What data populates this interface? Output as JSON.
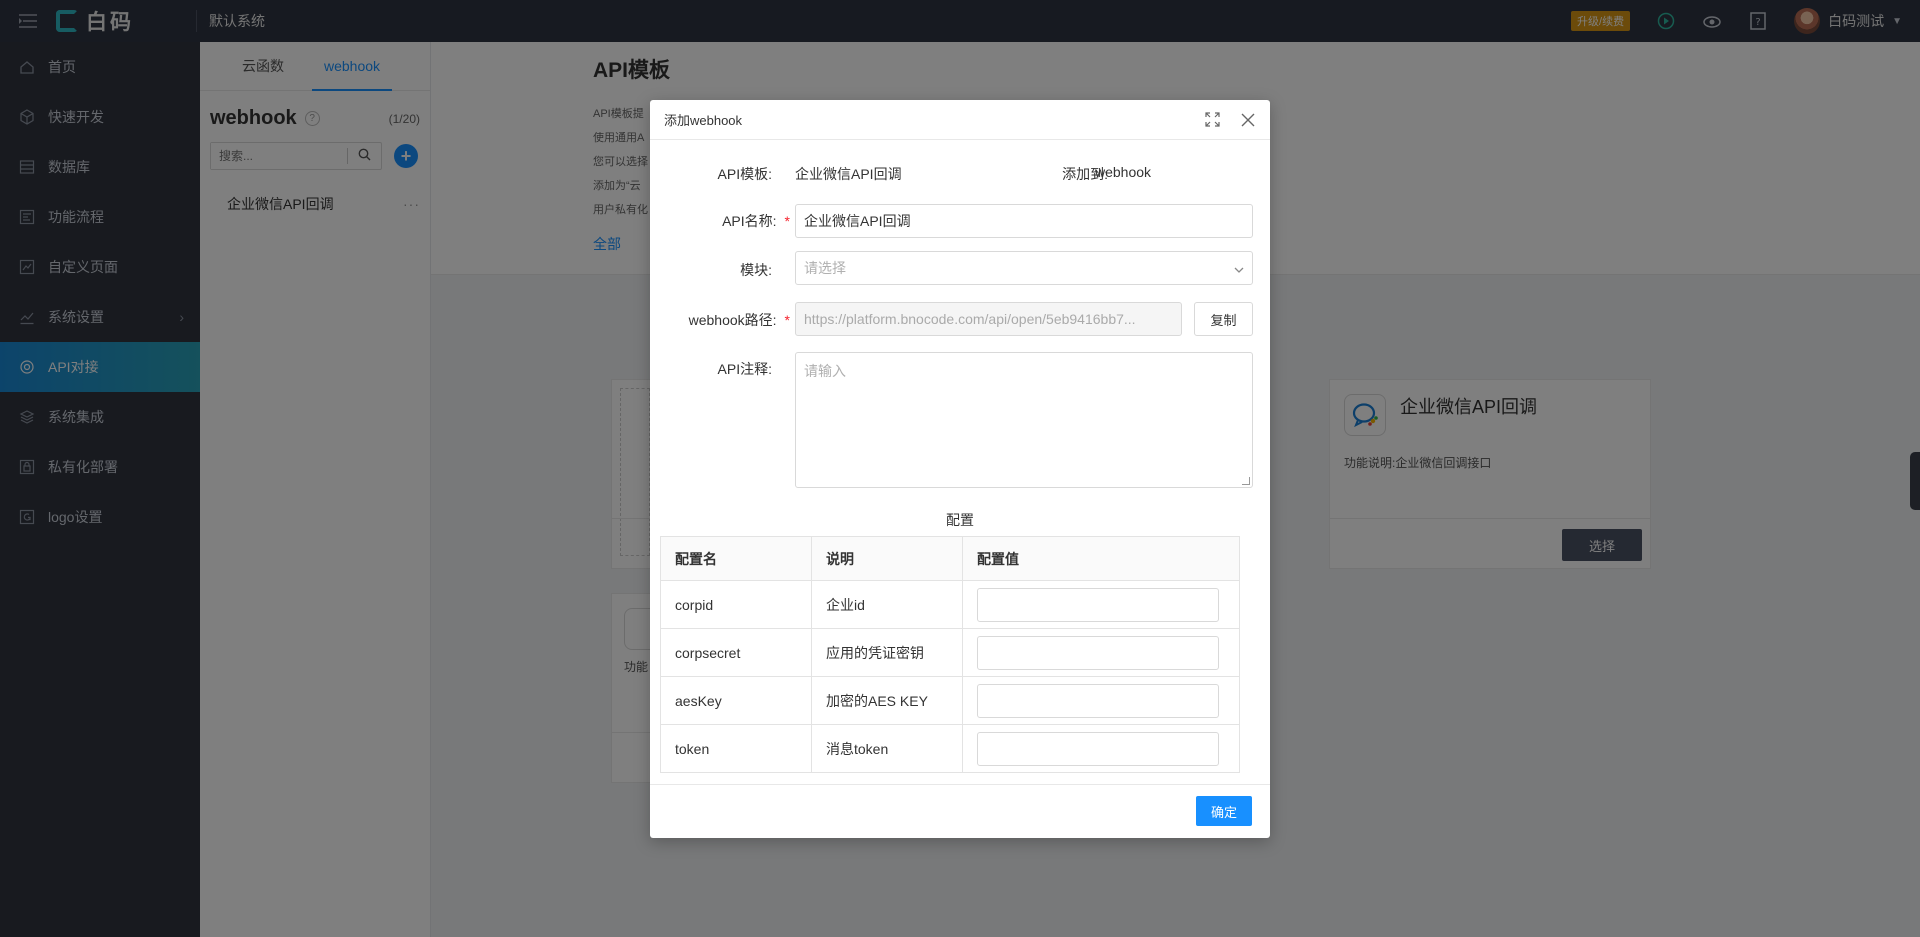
{
  "topbar": {
    "logo_text": "白码",
    "system_name": "默认系统",
    "upgrade_label": "升级/续费",
    "user_name": "白码测试"
  },
  "sidebar": {
    "items": [
      {
        "label": "首页",
        "icon": "home-icon"
      },
      {
        "label": "快速开发",
        "icon": "cube-icon"
      },
      {
        "label": "数据库",
        "icon": "database-icon"
      },
      {
        "label": "功能流程",
        "icon": "flow-icon"
      },
      {
        "label": "自定义页面",
        "icon": "page-icon"
      },
      {
        "label": "系统设置",
        "icon": "chart-icon"
      },
      {
        "label": "API对接",
        "icon": "api-icon"
      },
      {
        "label": "系统集成",
        "icon": "layers-icon"
      },
      {
        "label": "私有化部署",
        "icon": "lock-icon"
      },
      {
        "label": "logo设置",
        "icon": "logo-icon"
      }
    ]
  },
  "panel": {
    "tabs": [
      "云函数",
      "webhook"
    ],
    "title": "webhook",
    "count": "(1/20)",
    "search_placeholder": "搜索...",
    "items": [
      "企业微信API回调"
    ]
  },
  "main": {
    "title": "API模板",
    "desc_lines": [
      "API模板提",
      "使用通用A",
      "您可以选择",
      "添加为“云",
      "用户私有化"
    ],
    "filter_all": "全部",
    "card_right": {
      "title": "企业微信API回调",
      "desc": "功能说明:企业微信回调接口",
      "button": "选择"
    },
    "card_left_bottom_fragment": "功能"
  },
  "modal": {
    "title": "添加webhook",
    "template_label": "API模板:",
    "template_value": "企业微信API回调",
    "add_to_label": "添加到:",
    "add_to_value": "webhook",
    "name_label": "API名称:",
    "name_value": "企业微信API回调",
    "module_label": "模块:",
    "module_placeholder": "请选择",
    "path_label": "webhook路径:",
    "path_value": "https://platform.bnocode.com/api/open/5eb9416bb7...",
    "copy_label": "复制",
    "note_label": "API注释:",
    "note_placeholder": "请输入",
    "config_title": "配置",
    "config_headers": [
      "配置名",
      "说明",
      "配置值"
    ],
    "config_rows": [
      {
        "name": "corpid",
        "desc": "企业id",
        "value": ""
      },
      {
        "name": "corpsecret",
        "desc": "应用的凭证密钥",
        "value": ""
      },
      {
        "name": "aesKey",
        "desc": "加密的AES KEY",
        "value": ""
      },
      {
        "name": "token",
        "desc": "消息token",
        "value": ""
      }
    ],
    "ok_label": "确定"
  }
}
